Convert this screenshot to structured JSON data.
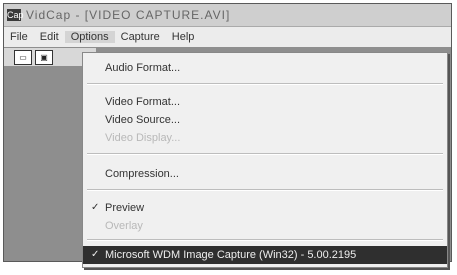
{
  "window": {
    "icon_text": "Cap",
    "title": "VidCap - [VIDEO CAPTURE.AVI]"
  },
  "menubar": {
    "items": [
      "File",
      "Edit",
      "Options",
      "Capture",
      "Help"
    ]
  },
  "toolbar": {
    "buttons": [
      "▭",
      "▣"
    ]
  },
  "options_menu": {
    "items": [
      {
        "label": "Audio Format...",
        "checked": false,
        "disabled": false
      },
      {
        "label": "Video Format...",
        "checked": false,
        "disabled": false
      },
      {
        "label": "Video Source...",
        "checked": false,
        "disabled": false
      },
      {
        "label": "Video Display...",
        "checked": false,
        "disabled": true
      },
      {
        "label": "Compression...",
        "checked": false,
        "disabled": false
      },
      {
        "label": "Preview",
        "checked": true,
        "check_mark": "✓",
        "disabled": false
      },
      {
        "label": "Overlay",
        "checked": false,
        "disabled": true
      },
      {
        "label": "Microsoft WDM Image Capture (Win32) - 5.00.2195",
        "checked": true,
        "check_mark": "✓",
        "disabled": false,
        "selected": true
      }
    ]
  }
}
